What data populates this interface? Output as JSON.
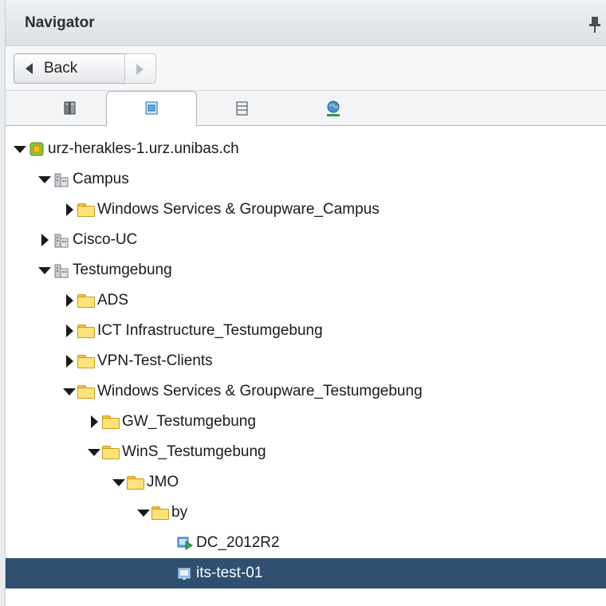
{
  "header": {
    "title": "Navigator"
  },
  "toolbar": {
    "back_label": "Back"
  },
  "tabs": [
    {
      "name": "hosts-clusters",
      "icon": "hosts-icon"
    },
    {
      "name": "vms-templates",
      "icon": "vms-templates-icon",
      "active": true
    },
    {
      "name": "storage",
      "icon": "storage-icon"
    },
    {
      "name": "networking",
      "icon": "network-icon"
    }
  ],
  "tree": [
    {
      "label": "urz-herakles-1.urz.unibas.ch",
      "level": 0,
      "expanded": true,
      "icon": "vcenter-icon"
    },
    {
      "label": "Campus",
      "level": 1,
      "expanded": true,
      "icon": "datacenter-icon"
    },
    {
      "label": "Windows Services & Groupware_Campus",
      "level": 2,
      "expanded": false,
      "icon": "folder-icon"
    },
    {
      "label": "Cisco-UC",
      "level": 1,
      "expanded": false,
      "icon": "datacenter-icon"
    },
    {
      "label": "Testumgebung",
      "level": 1,
      "expanded": true,
      "icon": "datacenter-icon"
    },
    {
      "label": "ADS",
      "level": 2,
      "expanded": false,
      "icon": "folder-icon"
    },
    {
      "label": "ICT Infrastructure_Testumgebung",
      "level": 2,
      "expanded": false,
      "icon": "folder-icon"
    },
    {
      "label": "VPN-Test-Clients",
      "level": 2,
      "expanded": false,
      "icon": "folder-icon"
    },
    {
      "label": "Windows Services & Groupware_Testumgebung",
      "level": 2,
      "expanded": true,
      "icon": "folder-icon"
    },
    {
      "label": "GW_Testumgebung",
      "level": 3,
      "expanded": false,
      "icon": "folder-icon"
    },
    {
      "label": "WinS_Testumgebung",
      "level": 3,
      "expanded": true,
      "icon": "folder-icon"
    },
    {
      "label": "JMO",
      "level": 4,
      "expanded": true,
      "icon": "folder-icon"
    },
    {
      "label": "by",
      "level": 5,
      "expanded": true,
      "icon": "folder-icon"
    },
    {
      "label": "DC_2012R2",
      "level": 6,
      "leaf": true,
      "icon": "vm-powered-on-icon"
    },
    {
      "label": "its-test-01",
      "level": 6,
      "leaf": true,
      "icon": "vm-icon",
      "selected": true
    }
  ],
  "colors": {
    "selection": "#2e4f70",
    "header_bg": "#dde1e5",
    "folder": "#ffe27a"
  }
}
